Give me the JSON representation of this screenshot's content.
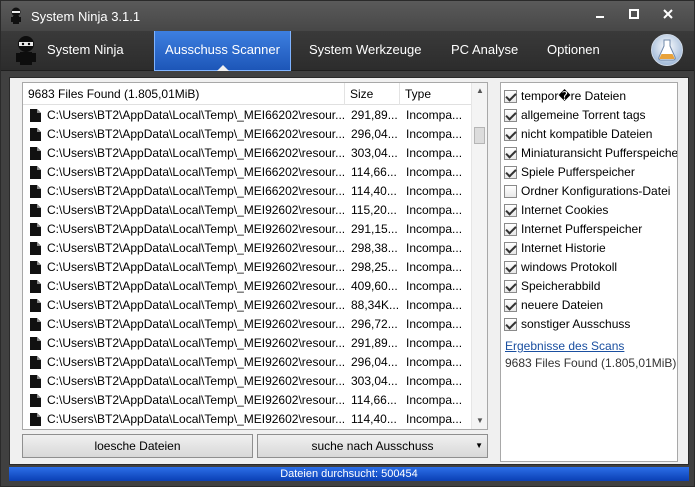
{
  "window": {
    "title": "System Ninja 3.1.1",
    "controls": [
      "minimize",
      "maximize",
      "close"
    ]
  },
  "nav": {
    "tabs": [
      {
        "label": "System Ninja",
        "active": false
      },
      {
        "label": "Ausschuss Scanner",
        "active": true
      },
      {
        "label": "System Werkzeuge",
        "active": false
      },
      {
        "label": "PC Analyse",
        "active": false
      },
      {
        "label": "Optionen",
        "active": false
      }
    ]
  },
  "file_list": {
    "header_summary": "9683 Files Found (1.805,01MiB)",
    "columns": [
      "Size",
      "Type"
    ],
    "rows": [
      {
        "path": "C:\\Users\\BT2\\AppData\\Local\\Temp\\_MEI66202\\resour...",
        "size": "291,89...",
        "type": "Incompa..."
      },
      {
        "path": "C:\\Users\\BT2\\AppData\\Local\\Temp\\_MEI66202\\resour...",
        "size": "296,04...",
        "type": "Incompa..."
      },
      {
        "path": "C:\\Users\\BT2\\AppData\\Local\\Temp\\_MEI66202\\resour...",
        "size": "303,04...",
        "type": "Incompa..."
      },
      {
        "path": "C:\\Users\\BT2\\AppData\\Local\\Temp\\_MEI66202\\resour...",
        "size": "114,66...",
        "type": "Incompa..."
      },
      {
        "path": "C:\\Users\\BT2\\AppData\\Local\\Temp\\_MEI66202\\resour...",
        "size": "114,40...",
        "type": "Incompa..."
      },
      {
        "path": "C:\\Users\\BT2\\AppData\\Local\\Temp\\_MEI92602\\resour...",
        "size": "115,20...",
        "type": "Incompa..."
      },
      {
        "path": "C:\\Users\\BT2\\AppData\\Local\\Temp\\_MEI92602\\resour...",
        "size": "291,15...",
        "type": "Incompa..."
      },
      {
        "path": "C:\\Users\\BT2\\AppData\\Local\\Temp\\_MEI92602\\resour...",
        "size": "298,38...",
        "type": "Incompa..."
      },
      {
        "path": "C:\\Users\\BT2\\AppData\\Local\\Temp\\_MEI92602\\resour...",
        "size": "298,25...",
        "type": "Incompa..."
      },
      {
        "path": "C:\\Users\\BT2\\AppData\\Local\\Temp\\_MEI92602\\resour...",
        "size": "409,60...",
        "type": "Incompa..."
      },
      {
        "path": "C:\\Users\\BT2\\AppData\\Local\\Temp\\_MEI92602\\resour...",
        "size": "88,34K...",
        "type": "Incompa..."
      },
      {
        "path": "C:\\Users\\BT2\\AppData\\Local\\Temp\\_MEI92602\\resour...",
        "size": "296,72...",
        "type": "Incompa..."
      },
      {
        "path": "C:\\Users\\BT2\\AppData\\Local\\Temp\\_MEI92602\\resour...",
        "size": "291,89...",
        "type": "Incompa..."
      },
      {
        "path": "C:\\Users\\BT2\\AppData\\Local\\Temp\\_MEI92602\\resour...",
        "size": "296,04...",
        "type": "Incompa..."
      },
      {
        "path": "C:\\Users\\BT2\\AppData\\Local\\Temp\\_MEI92602\\resour...",
        "size": "303,04...",
        "type": "Incompa..."
      },
      {
        "path": "C:\\Users\\BT2\\AppData\\Local\\Temp\\_MEI92602\\resour...",
        "size": "114,66...",
        "type": "Incompa..."
      },
      {
        "path": "C:\\Users\\BT2\\AppData\\Local\\Temp\\_MEI92602\\resour...",
        "size": "114,40...",
        "type": "Incompa..."
      }
    ]
  },
  "actions": {
    "delete_label": "loesche Dateien",
    "scan_label": "suche nach Ausschuss"
  },
  "categories": [
    {
      "label": "tempor�re Dateien",
      "checked": true
    },
    {
      "label": "allgemeine Torrent tags",
      "checked": true
    },
    {
      "label": "nicht kompatible Dateien",
      "checked": true
    },
    {
      "label": "Miniaturansicht Pufferspeicher",
      "checked": true
    },
    {
      "label": "Spiele Pufferspeicher",
      "checked": true
    },
    {
      "label": "Ordner Konfigurations-Datei",
      "checked": false
    },
    {
      "label": "Internet Cookies",
      "checked": true
    },
    {
      "label": "Internet Pufferspeicher",
      "checked": true
    },
    {
      "label": "Internet Historie",
      "checked": true
    },
    {
      "label": "windows Protokoll",
      "checked": true
    },
    {
      "label": "Speicherabbild",
      "checked": true
    },
    {
      "label": "neuere Dateien",
      "checked": true
    },
    {
      "label": "sonstiger Ausschuss",
      "checked": true
    }
  ],
  "scan_results": {
    "link_label": "Ergebnisse des Scans",
    "value": "9683 Files Found (1.805,01MiB)"
  },
  "status": {
    "text": "Dateien durchsucht: 500454"
  },
  "colors": {
    "accent": "#1d56b8",
    "status_bar": "#0a3fb4",
    "window_bg": "#404040"
  }
}
